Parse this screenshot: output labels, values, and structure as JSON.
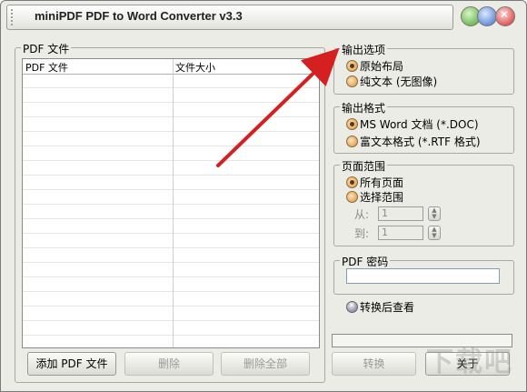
{
  "window": {
    "title": "miniPDF PDF to Word Converter v3.3"
  },
  "files_panel": {
    "legend": "PDF 文件",
    "columns": [
      "PDF 文件",
      "文件大小"
    ]
  },
  "output_options": {
    "legend": "输出选项",
    "items": [
      {
        "label": "原始布局",
        "selected": true
      },
      {
        "label": "纯文本 (无图像)",
        "selected": false
      }
    ]
  },
  "output_format": {
    "legend": "输出格式",
    "items": [
      {
        "label": "MS Word 文档 (*.DOC)",
        "selected": true
      },
      {
        "label": "富文本格式 (*.RTF 格式)",
        "selected": false
      }
    ]
  },
  "page_range": {
    "legend": "页面范围",
    "items": [
      {
        "label": "所有页面",
        "selected": true
      },
      {
        "label": "选择范围",
        "selected": false
      }
    ],
    "from_label": "从:",
    "from_value": "1",
    "to_label": "到:",
    "to_value": "1"
  },
  "password": {
    "legend": "PDF 密码",
    "value": ""
  },
  "view_after": {
    "label": "转换后查看"
  },
  "buttons": {
    "add": "添加 PDF 文件",
    "delete": "删除",
    "delete_all": "删除全部",
    "convert": "转换",
    "close": "关于"
  },
  "watermark": "下载吧",
  "colors": {
    "annotation_arrow": "#d42020",
    "window_bg": "#ecece6"
  }
}
